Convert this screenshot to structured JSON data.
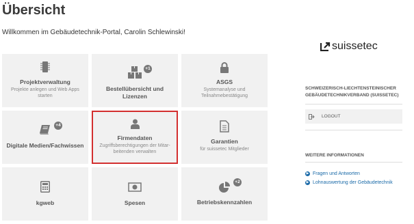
{
  "header": {
    "title": "Übersicht",
    "welcome": "Willkommen im Gebäudetechnik-Portal, Carolin Schlewinski!"
  },
  "tiles": [
    {
      "title": "Projektverwaltung",
      "subtitle": "Projekte anlegen und Web Apps starten",
      "icon": "chip-icon"
    },
    {
      "title": "Bestellübersicht und Lizenzen",
      "subtitle": "",
      "icon": "boxes-icon",
      "badge": "+1"
    },
    {
      "title": "ASGS",
      "subtitle": "Systemanalyse und Teilnahmebestätigung",
      "icon": "lock-icon"
    },
    {
      "title": "Digitale Medien/Fachwissen",
      "subtitle": "",
      "icon": "book-icon",
      "badge": "+4"
    },
    {
      "title": "Firmendaten",
      "subtitle": "Zugriffsberechtigungen der Mitar-beitenden verwalten",
      "icon": "user-icon",
      "selected": true
    },
    {
      "title": "Garantien",
      "subtitle": "für suissetec Mitglieder",
      "icon": "document-icon"
    },
    {
      "title": "kgweb",
      "subtitle": "",
      "icon": "calculator-icon"
    },
    {
      "title": "Spesen",
      "subtitle": "",
      "icon": "money-icon"
    },
    {
      "title": "Betriebskennzahlen",
      "subtitle": "",
      "icon": "pie-chart-icon",
      "badge": "+2"
    }
  ],
  "sidebar": {
    "logo_text": "suissetec",
    "org_name_line1": "SCHWEIZERISCH-LIECHTENSTEINISCHER",
    "org_name_line2": "GEBÄUDETECHNIKVERBAND (SUISSETEC)",
    "logout_label": "LOGOUT",
    "more_info_heading": "WEITERE INFORMATIONEN",
    "links": [
      "Fragen und Antworten",
      "Lohnauswertung der Gebäudetechnik"
    ]
  },
  "colors": {
    "accent_link": "#1a6aa8",
    "selected_border": "#d32f2f",
    "tile_bg": "#f1f1f1"
  }
}
